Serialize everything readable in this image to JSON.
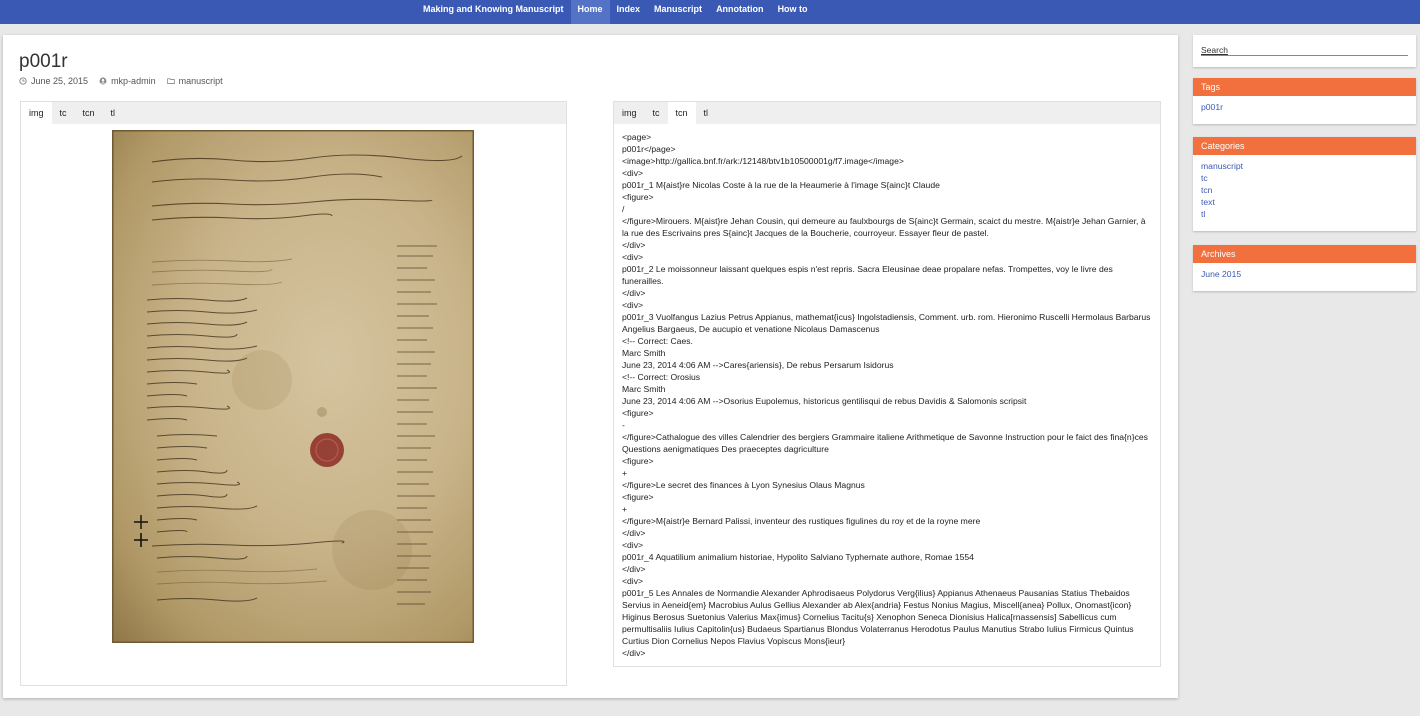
{
  "nav": {
    "items": [
      {
        "label": "Making and Knowing Manuscript",
        "active": false
      },
      {
        "label": "Home",
        "active": true
      },
      {
        "label": "Index",
        "active": false
      },
      {
        "label": "Manuscript",
        "active": false
      },
      {
        "label": "Annotation",
        "active": false
      },
      {
        "label": "How to",
        "active": false
      }
    ],
    "color": "#3a59b4"
  },
  "post": {
    "title": "p001r",
    "date": "June 25, 2015",
    "author": "mkp-admin",
    "category": "manuscript",
    "icons": [
      "clock-icon",
      "user-icon",
      "folder-icon"
    ]
  },
  "left_panel": {
    "tabs": [
      "img",
      "tc",
      "tcn",
      "tl"
    ],
    "active_tab": "img"
  },
  "right_panel": {
    "tabs": [
      "img",
      "tc",
      "tcn",
      "tl"
    ],
    "active_tab": "tcn",
    "lines": [
      "<page>",
      "p001r</page>",
      "<image>http://gallica.bnf.fr/ark:/12148/btv1b10500001g/f7.image</image>",
      "<div>",
      "p001r_1 M{aist}re Nicolas Coste à la rue de la Heaumerie à l'image S{ainc}t Claude",
      "<figure>",
      "/",
      "</figure>Mirouers. M{aist}re Jehan Cousin, qui demeure au faulxbourgs de S{ainc}t Germain, scaict du mestre. M{aistr}e Jehan Garnier, à la rue des Escrivains pres S{ainc}t Jacques de la Boucherie, courroyeur. Essayer fleur de pastel.",
      "</div>",
      "<div>",
      "p001r_2 Le moissonneur laissant quelques espis n'est repris. Sacra Eleusinae deae propalare nefas. Trompettes, voy le livre des funerailles.",
      "</div>",
      "<div>",
      "p001r_3 Vuolfangus Lazius Petrus Appianus, mathemat{icus} Ingolstadiensis, Comment. urb. rom. Hieronimo Ruscelli Hermolaus Barbarus Angelius Bargaeus, De aucupio et venatione Nicolaus Damascenus",
      "<!-- Correct: Caes.",
      "Marc Smith",
      "June 23, 2014 4:06 AM -->Cares{ariensis}, De rebus Persarum Isidorus",
      "<!-- Correct: Orosius",
      "Marc Smith",
      "June 23, 2014 4:06 AM -->Osorius Eupolemus, historicus gentilisqui de rebus Davidis & Salomonis scripsit",
      "<figure>",
      "-",
      "</figure>Cathalogue des villes Calendrier des bergiers Grammaire italiene Arithmetique de Savonne Instruction pour le faict des fina{n}ces Questions aenigmatiques Des praeceptes dagriculture",
      "<figure>",
      "+",
      "</figure>Le secret des finances à Lyon Synesius Olaus Magnus",
      "<figure>",
      "+",
      "</figure>M{aistr}e Bernard Palissi, inventeur des rustiques figulines du roy et de la royne mere",
      "</div>",
      "<div>",
      "p001r_4 Aquatilium animalium historiae, Hypolito Salviano Typhernate authore, Romae 1554",
      "</div>",
      "<div>",
      "p001r_5 Les Annales de Normandie Alexander Aphrodisaeus Polydorus Verg{ilius} Appianus Athenaeus Pausanias Statius Thebaidos Servius in Aeneid{em} Macrobius Aulus Gellius Alexander ab Alex{andria} Festus Nonius Magius, Miscell{anea} Pollux, Onomast{icon} Higinus Berosus Suetonius Valerius Max{imus} Cornelius Tacitu{s} Xenophon Seneca Dionisius Halica[rnassensis] Sabellicus cum permultisaliis Iulius Capitolin{us} Budaeus Spartianus Blondus Volaterranus Herodotus Paulus Manutius Strabo Iulius Firmicus Quintus Curtius Dion Cornelius Nepos Flavius Vopiscus Mons{ieur}",
      "</div>"
    ]
  },
  "sidebar": {
    "search_placeholder": "Search",
    "tags_title": "Tags",
    "tags": [
      "p001r"
    ],
    "categories_title": "Categories",
    "categories": [
      "manuscript",
      "tc",
      "tcn",
      "text",
      "tl"
    ],
    "archives_title": "Archives",
    "archives": [
      "June 2015"
    ],
    "accent": "#f2703e"
  }
}
